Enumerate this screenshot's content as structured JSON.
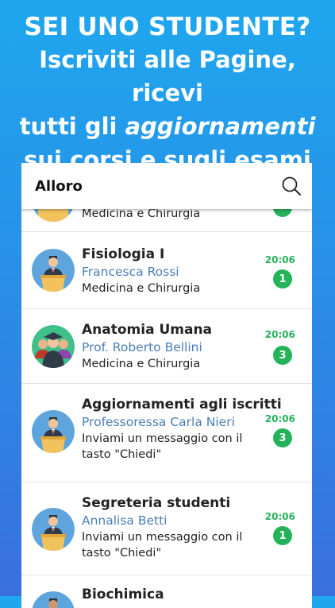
{
  "promo": {
    "line1": "SEI UNO STUDENTE?",
    "line2": "Iscriviti alle Pagine, ricevi",
    "line3_pre": "tutti gli ",
    "line3_em": "aggiornamenti",
    "line4": "sui corsi e sugli esami"
  },
  "appbar": {
    "title": "Alloro",
    "search_icon": "search-icon"
  },
  "colors": {
    "accent_green": "#25b35a",
    "name_blue": "#4a7fb5"
  },
  "conversations": [
    {
      "title": "",
      "subtitle": "",
      "preview": "Medicina e Chirurgia",
      "time": "",
      "unread": ""
    },
    {
      "title": "Fisiologia I",
      "subtitle": "Francesca Rossi",
      "preview": "Medicina e Chirurgia",
      "time": "20:06",
      "unread": "1",
      "avatar": "teacher-avatar"
    },
    {
      "title": "Anatomia Umana",
      "subtitle": "Prof. Roberto Bellini",
      "preview": "Medicina e Chirurgia",
      "time": "20:06",
      "unread": "3",
      "avatar": "graduates-avatar"
    },
    {
      "title": "Aggiornamenti agli iscritti",
      "subtitle": "Professoressa Carla Nieri",
      "preview": "Inviami un messaggio con il tasto \"Chiedi\"",
      "time": "20:06",
      "unread": "3",
      "avatar": "teacher-avatar"
    },
    {
      "title": "Segreteria studenti",
      "subtitle": "Annalisa Betti",
      "preview": "Inviami un messaggio con il tasto \"Chiedi\"",
      "time": "20:06",
      "unread": "1",
      "avatar": "teacher-avatar"
    },
    {
      "title": "Biochimica",
      "subtitle": "",
      "preview": "",
      "time": "",
      "unread": "",
      "avatar": "teacher-avatar"
    }
  ]
}
